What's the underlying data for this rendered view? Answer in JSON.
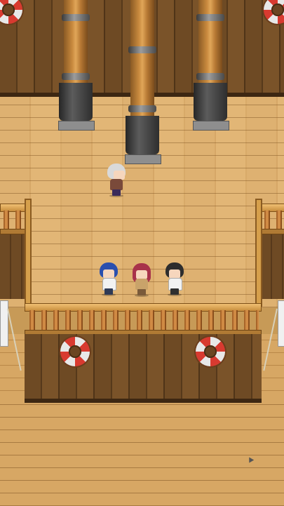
{
  "scene": {
    "name": "ship-deck",
    "layout": "top-down-tile-map"
  },
  "colors": {
    "deck_plank": "#dcae6e",
    "wall_plank": "#6e4a24",
    "railing": "#d6a04c",
    "mast_wood": "#c8893e",
    "mast_metal": "#4a4a4a",
    "ring_red": "#d83a30",
    "ring_white": "#e8e8e8"
  },
  "objects": {
    "masts": [
      "mast-left",
      "mast-center",
      "mast-right"
    ],
    "life_rings": [
      "life-ring-top-left",
      "life-ring-top-right",
      "life-ring-hull-left",
      "life-ring-hull-right"
    ]
  },
  "characters": [
    {
      "id": "npc-old-man",
      "hair": "#d9d9d9",
      "outfit": "#7a4a3a",
      "facing": "right"
    },
    {
      "id": "party-blue-hair",
      "hair": "#2a4fae",
      "outfit": "#f2f2f2",
      "facing": "down"
    },
    {
      "id": "party-pink-hair",
      "hair": "#a8324a",
      "outfit": "#c9a36a",
      "facing": "down"
    },
    {
      "id": "party-black-hair",
      "hair": "#2d2d2d",
      "outfit": "#f2f2f2",
      "facing": "down"
    }
  ]
}
